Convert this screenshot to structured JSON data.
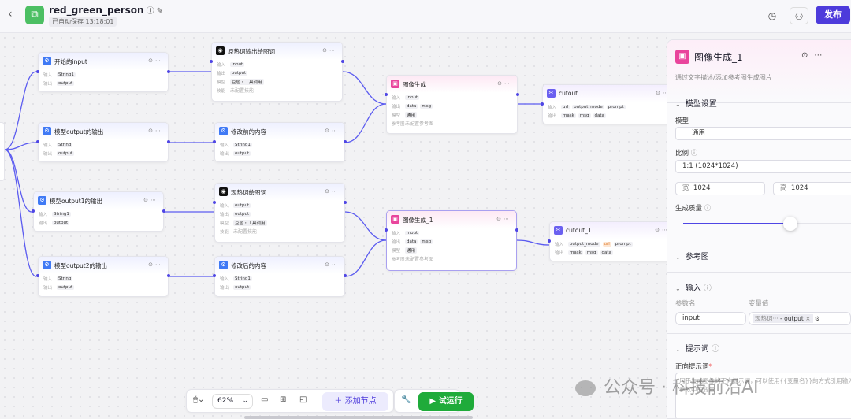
{
  "header": {
    "title": "red_green_person",
    "saved": "已自动保存 13:18:01",
    "publish": "发布"
  },
  "nodes": [
    {
      "id": "n1",
      "kind": "code",
      "title": "开始的input",
      "rows": [
        [
          "输入",
          [
            "String1"
          ]
        ],
        [
          "输出",
          [
            "output"
          ]
        ]
      ]
    },
    {
      "id": "n2",
      "kind": "llm",
      "title": "原热词输出绘图词",
      "rows": [
        [
          "输入",
          [
            "input"
          ]
        ],
        [
          "输出",
          [
            "output"
          ]
        ],
        [
          "模型",
          [
            "豆包・工具调用"
          ]
        ],
        [
          "技能",
          [
            "未配置技能"
          ]
        ]
      ]
    },
    {
      "id": "n3",
      "kind": "code",
      "title": "模型output的输出",
      "rows": [
        [
          "输入",
          [
            "String"
          ]
        ],
        [
          "输出",
          [
            "output"
          ]
        ]
      ]
    },
    {
      "id": "n4",
      "kind": "code",
      "title": "修改前的内容",
      "rows": [
        [
          "输入",
          [
            "String1"
          ]
        ],
        [
          "输出",
          [
            "output"
          ]
        ]
      ]
    },
    {
      "id": "n5",
      "kind": "code",
      "title": "模型output1的输出",
      "rows": [
        [
          "输入",
          [
            "String1"
          ]
        ],
        [
          "输出",
          [
            "output"
          ]
        ]
      ]
    },
    {
      "id": "n6",
      "kind": "llm",
      "title": "现热词绘图词",
      "rows": [
        [
          "输入",
          [
            "output"
          ]
        ],
        [
          "输出",
          [
            "output"
          ]
        ],
        [
          "模型",
          [
            "豆包・工具调用"
          ]
        ],
        [
          "技能",
          [
            "未配置技能"
          ]
        ]
      ]
    },
    {
      "id": "n7",
      "kind": "code",
      "title": "模型output2的输出",
      "rows": [
        [
          "输入",
          [
            "String"
          ]
        ],
        [
          "输出",
          [
            "output"
          ]
        ]
      ]
    },
    {
      "id": "n8",
      "kind": "code",
      "title": "修改后的内容",
      "rows": [
        [
          "输入",
          [
            "String1"
          ]
        ],
        [
          "输出",
          [
            "output"
          ]
        ]
      ]
    },
    {
      "id": "n9",
      "kind": "img",
      "title": "图像生成",
      "rows": [
        [
          "输入",
          [
            "input"
          ]
        ],
        [
          "输出",
          [
            "data",
            "msg"
          ]
        ],
        [
          "模型",
          [
            "通用"
          ]
        ],
        [
          "参考图",
          [
            "未配置参考图"
          ]
        ]
      ]
    },
    {
      "id": "n10",
      "kind": "cut",
      "title": "cutout",
      "rows": [
        [
          "输入",
          [
            "url",
            "output_mode",
            "prompt"
          ]
        ],
        [
          "输出",
          [
            "mask",
            "msg",
            "data"
          ]
        ]
      ]
    },
    {
      "id": "n11",
      "kind": "img",
      "title": "图像生成_1",
      "selected": true,
      "rows": [
        [
          "输入",
          [
            "input"
          ]
        ],
        [
          "输出",
          [
            "data",
            "msg"
          ]
        ],
        [
          "模型",
          [
            "通用"
          ]
        ],
        [
          "参考图",
          [
            "未配置参考图"
          ]
        ]
      ]
    },
    {
      "id": "n12",
      "kind": "cut",
      "title": "cutout_1",
      "warn_tag": "url",
      "rows": [
        [
          "输入",
          [
            "output_mode",
            "url",
            "prompt"
          ]
        ],
        [
          "输出",
          [
            "mask",
            "msg",
            "data"
          ]
        ]
      ]
    }
  ],
  "panel": {
    "title": "图像生成_1",
    "desc": "通过文字描述/添加参考图生成图片",
    "model_section": "模型设置",
    "model_label": "模型",
    "model_value": "通用",
    "ratio_label": "比例",
    "ratio_value": "1:1 (1024*1024)",
    "width_label": "宽",
    "width_value": "1024",
    "height_label": "高",
    "height_value": "1024",
    "quality_label": "生成质量",
    "quality_fraction": 0.62,
    "ref_section": "参考图",
    "input_section": "输入",
    "param_name_label": "参数名",
    "var_value_label": "变量值",
    "param_name": "input",
    "var_source": "现热词···",
    "var_field": "- output",
    "prompt_section": "提示词",
    "positive_prompt_label": "正向提示词",
    "prompt_placeholder": "用于生成图像的正向提示词，可以使用{{变量名}}的方式引用输入参数中的变量"
  },
  "toolbar": {
    "zoom": "62%",
    "add_node": "添加节点",
    "run": "试运行"
  },
  "watermark": "公众号 · 科技前沿AI",
  "colors": {
    "accent": "#4d3bdb",
    "run": "#1fab3a",
    "edge": "#5b5bf0"
  }
}
